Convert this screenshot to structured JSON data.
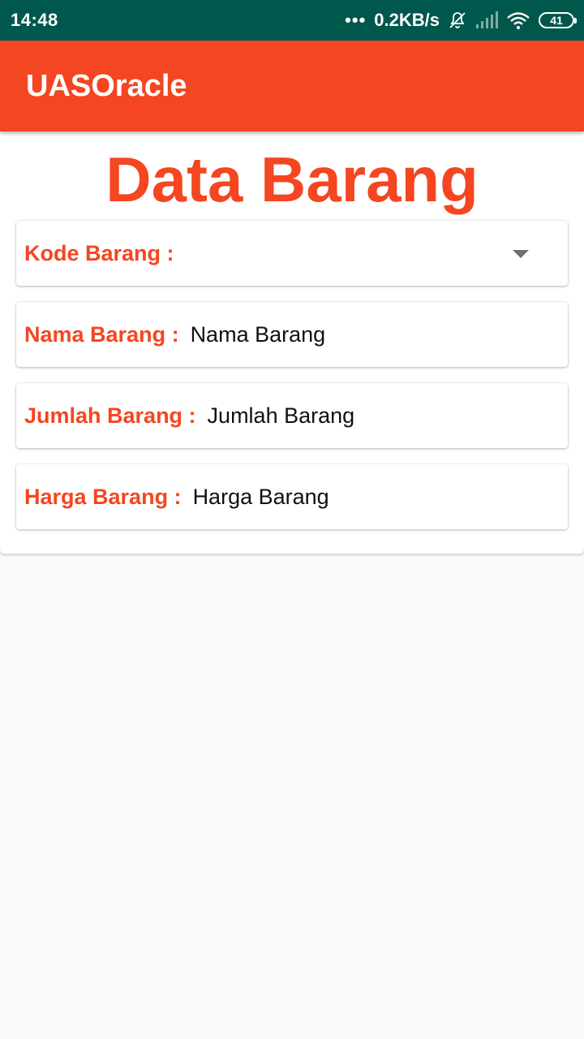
{
  "status_bar": {
    "time": "14:48",
    "dots": "•••",
    "network_speed": "0.2KB/s",
    "battery": "41",
    "icons": [
      "bell-off-icon",
      "signal-icon",
      "wifi-icon",
      "battery-icon"
    ],
    "background_color": "#00574b"
  },
  "app_bar": {
    "title": "UASOracle",
    "background_color": "#f44620"
  },
  "page": {
    "title": "Data Barang",
    "accent_color": "#f44620"
  },
  "form": {
    "kode": {
      "label": "Kode Barang :",
      "selected_value": ""
    },
    "nama": {
      "label": "Nama Barang :",
      "value": "Nama Barang"
    },
    "jumlah": {
      "label": "Jumlah Barang :",
      "value": "Jumlah Barang"
    },
    "harga": {
      "label": "Harga Barang :",
      "value": "Harga Barang"
    }
  }
}
